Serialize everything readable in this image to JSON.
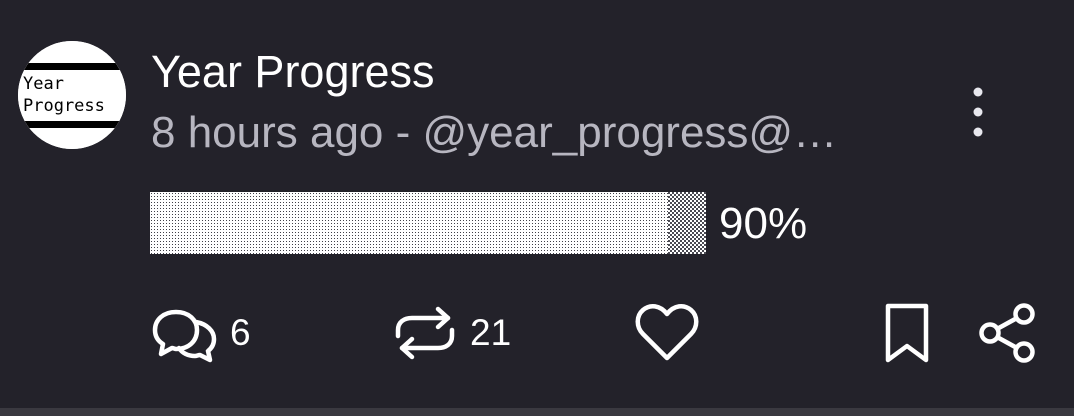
{
  "post": {
    "avatar": {
      "line1": "Year",
      "line2": "Progress",
      "icon": "year-progress-logo"
    },
    "author_name": "Year Progress",
    "meta": "8 hours ago - @year_progress@…",
    "progress": {
      "fraction": 0.9,
      "label": "90%"
    },
    "actions": {
      "replies": {
        "icon": "chat-bubbles-icon",
        "count": "6"
      },
      "boosts": {
        "icon": "repeat-icon",
        "count": "21"
      },
      "favourite": {
        "icon": "heart-icon"
      },
      "bookmark": {
        "icon": "bookmark-icon"
      },
      "share": {
        "icon": "share-icon"
      }
    },
    "menu": {
      "icon": "kebab-menu-icon"
    }
  },
  "colors": {
    "background": "#23222a",
    "text": "#ffffff",
    "meta_text": "#b7b6c0",
    "progress_fill": "#f0f0f0"
  }
}
